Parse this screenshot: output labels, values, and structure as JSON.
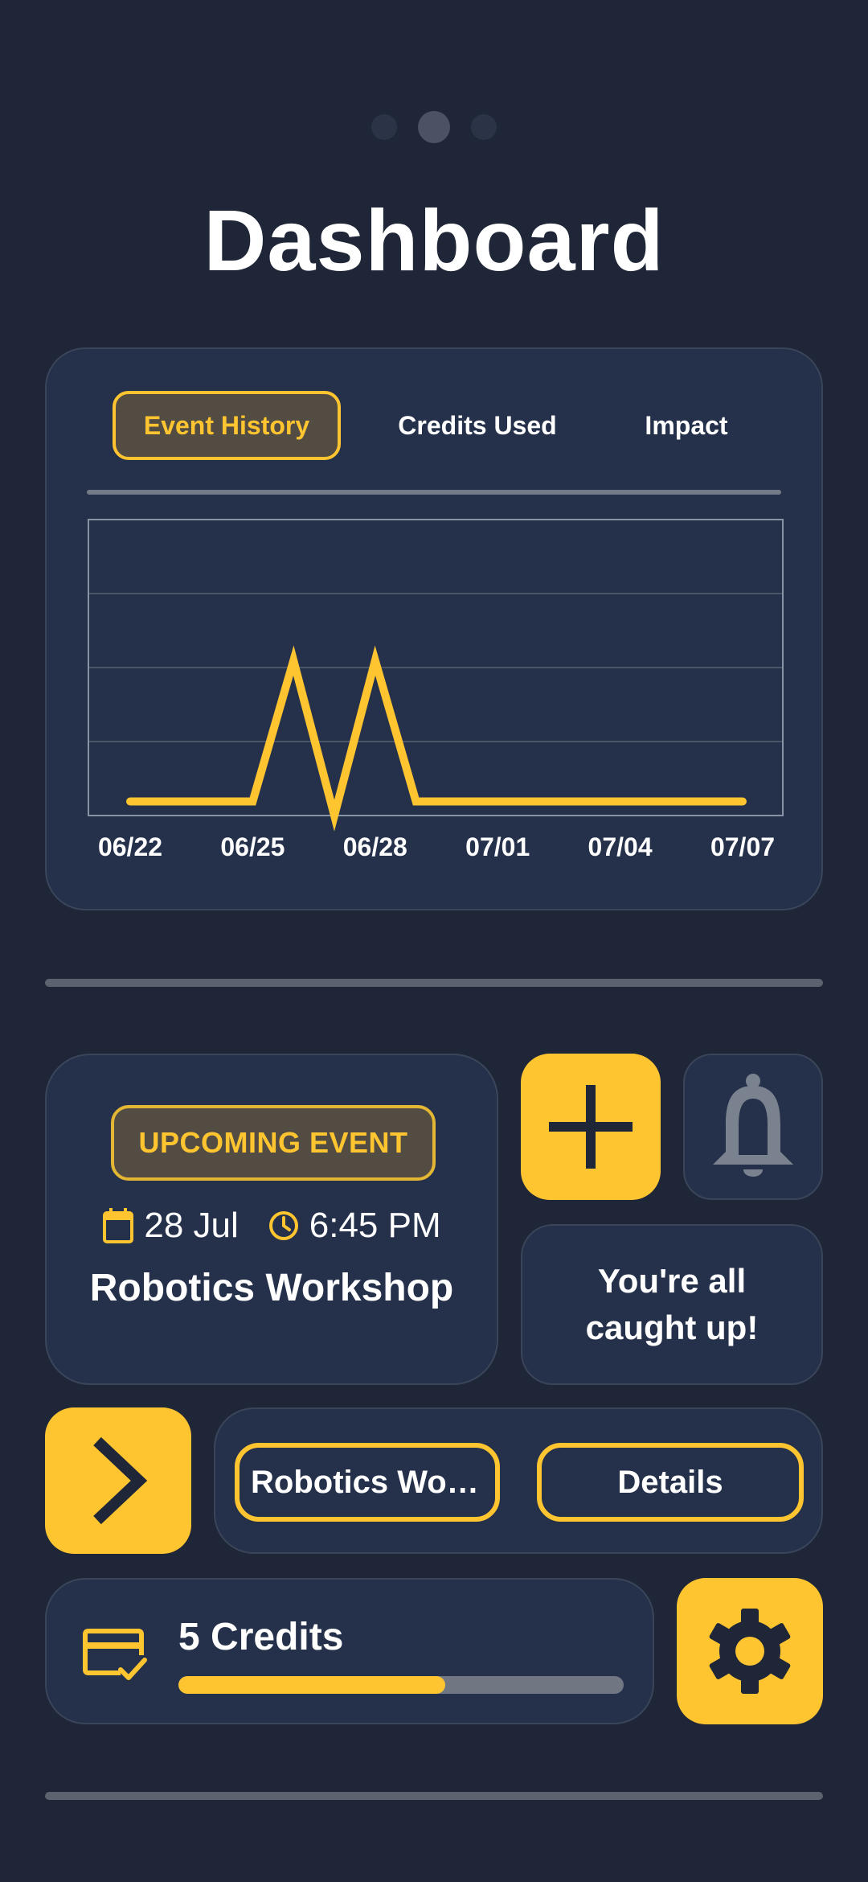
{
  "header": {
    "page_indicator": {
      "count": 3,
      "active_index": 1
    },
    "title": "Dashboard"
  },
  "chart_tabs": [
    {
      "label": "Event History",
      "active": true
    },
    {
      "label": "Credits Used",
      "active": false
    },
    {
      "label": "Impact",
      "active": false
    }
  ],
  "chart_data": {
    "type": "line",
    "x": [
      "06/22",
      "06/23",
      "06/24",
      "06/25",
      "06/26",
      "06/27",
      "06/28",
      "06/29",
      "06/30",
      "07/01",
      "07/02",
      "07/03",
      "07/04",
      "07/05",
      "07/06",
      "07/07"
    ],
    "x_tick_labels": [
      "06/22",
      "06/25",
      "06/28",
      "07/01",
      "07/04",
      "07/07"
    ],
    "series": [
      {
        "values": [
          0,
          0,
          0,
          0,
          1,
          -0.1,
          1,
          0,
          0,
          0,
          0,
          0,
          0,
          0,
          0,
          0
        ]
      }
    ],
    "ylim": [
      -0.1,
      2
    ],
    "grid": true,
    "colors": {
      "line": "#ffc530",
      "grid": "#4b5568",
      "frame": "#8a93a3"
    }
  },
  "upcoming_event": {
    "badge": "UPCOMING EVENT",
    "date": "28 Jul",
    "time": "6:45 PM",
    "name": "Robotics Workshop"
  },
  "notifications": {
    "message": "You're all caught up!"
  },
  "actions": {
    "event_button": "Robotics Workshop",
    "details_button": "Details"
  },
  "credits": {
    "label": "5 Credits",
    "progress_fraction": 0.6
  },
  "icons": {
    "add": "plus-icon",
    "bell": "bell-icon",
    "next": "chevron-right-icon",
    "credits": "card-check-icon",
    "settings": "gear-icon",
    "calendar": "calendar-icon",
    "clock": "clock-icon"
  },
  "colors": {
    "background": "#1e2638",
    "card": "#25314b",
    "accent": "#ffc530",
    "muted": "#5c636f"
  }
}
